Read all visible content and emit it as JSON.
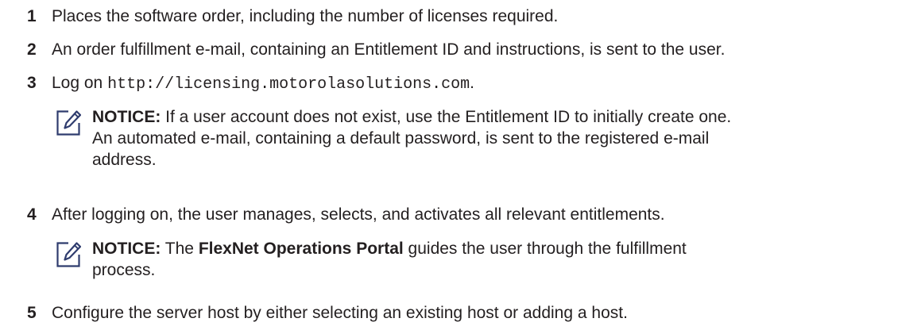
{
  "steps": [
    {
      "number": "1",
      "text": "Places the software order, including the number of licenses required."
    },
    {
      "number": "2",
      "text": "An order fulfillment e-mail, containing an Entitlement ID and instructions, is sent to the user."
    },
    {
      "number": "3",
      "text_before": "Log on ",
      "url": "http://licensing.motorolasolutions.com",
      "text_after": "."
    },
    {
      "number": "4",
      "text": "After logging on, the user manages, selects, and activates all relevant entitlements."
    },
    {
      "number": "5",
      "text": "Configure the server host by either selecting an existing host or adding a host."
    }
  ],
  "notices": [
    {
      "icon": "pencil-note-icon",
      "label": "NOTICE:",
      "lines": [
        " If a user account does not exist, use the Entitlement ID to initially create one.",
        "An automated e-mail, containing a default password, is sent to the registered e-mail",
        "address."
      ]
    },
    {
      "icon": "pencil-note-icon",
      "label": "NOTICE:",
      "text_before": " The ",
      "bold_term": "FlexNet Operations Portal",
      "text_after": " guides the user through the fulfillment",
      "line2": "process."
    }
  ],
  "colors": {
    "text": "#231f20",
    "icon": "#2f3c6e"
  }
}
